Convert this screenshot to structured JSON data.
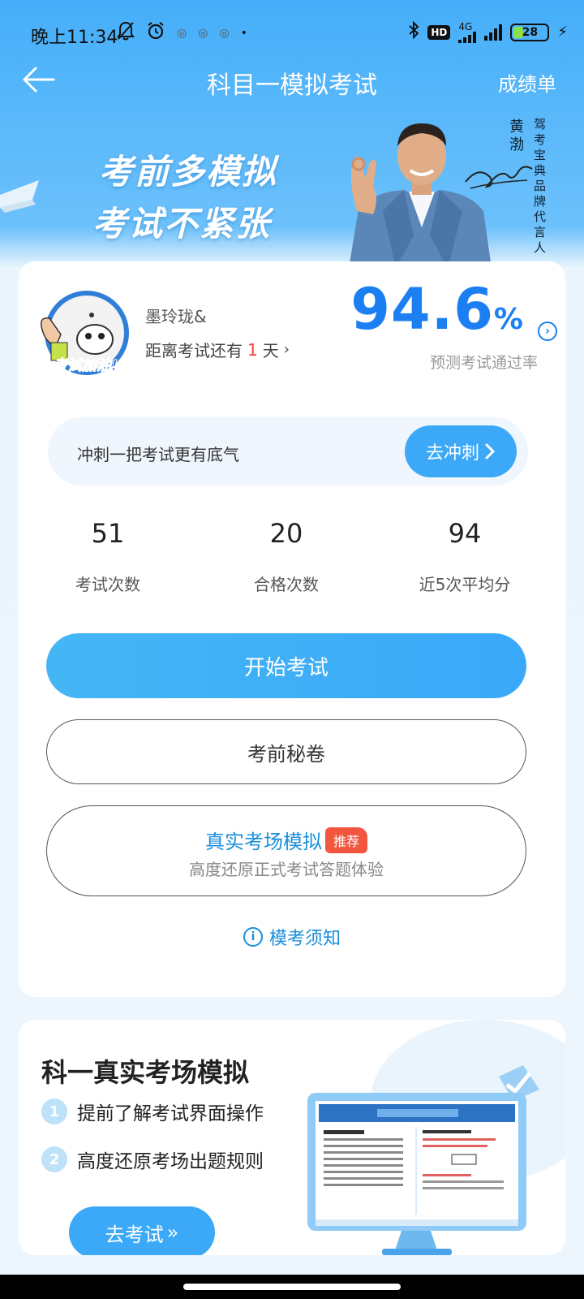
{
  "status_bar": {
    "time": "晚上11:34",
    "network": "4G",
    "hd": "HD",
    "battery": "28"
  },
  "header": {
    "title": "科目一模拟考试",
    "score_link": "成绩单"
  },
  "banner": {
    "slogan_line1": "考前多模拟",
    "slogan_line2": "考试不紧张",
    "ambassador_name": "黄渤",
    "ambassador_title": "驾考宝典品牌代言人"
  },
  "profile": {
    "avatar_text": "考试加油!",
    "name": "墨玲珑&",
    "countdown_prefix": "距离考试还有",
    "countdown_days": "1",
    "countdown_suffix": "天",
    "pass_rate_value": "94.6",
    "pass_rate_unit": "%",
    "pass_rate_label": "预测考试通过率"
  },
  "sprint": {
    "text": "冲刺一把考试更有底气",
    "button": "去冲刺"
  },
  "stats": [
    {
      "value": "51",
      "label": "考试次数"
    },
    {
      "value": "20",
      "label": "合格次数"
    },
    {
      "value": "94",
      "label": "近5次平均分"
    }
  ],
  "actions": {
    "start": "开始考试",
    "secret": "考前秘卷",
    "real_title": "真实考场模拟",
    "real_badge": "推荐",
    "real_subtitle": "高度还原正式考试答题体验",
    "notice": "模考须知"
  },
  "simulation": {
    "title": "科一真实考场模拟",
    "items": [
      {
        "num": "1",
        "text": "提前了解考试界面操作"
      },
      {
        "num": "2",
        "text": "高度还原考场出题规则"
      }
    ],
    "button": "去考试"
  },
  "colors": {
    "accent": "#3ba9f7",
    "pass_rate": "#1b7ff2",
    "badge": "#f2563f",
    "countdown_days": "#ff3b30"
  }
}
